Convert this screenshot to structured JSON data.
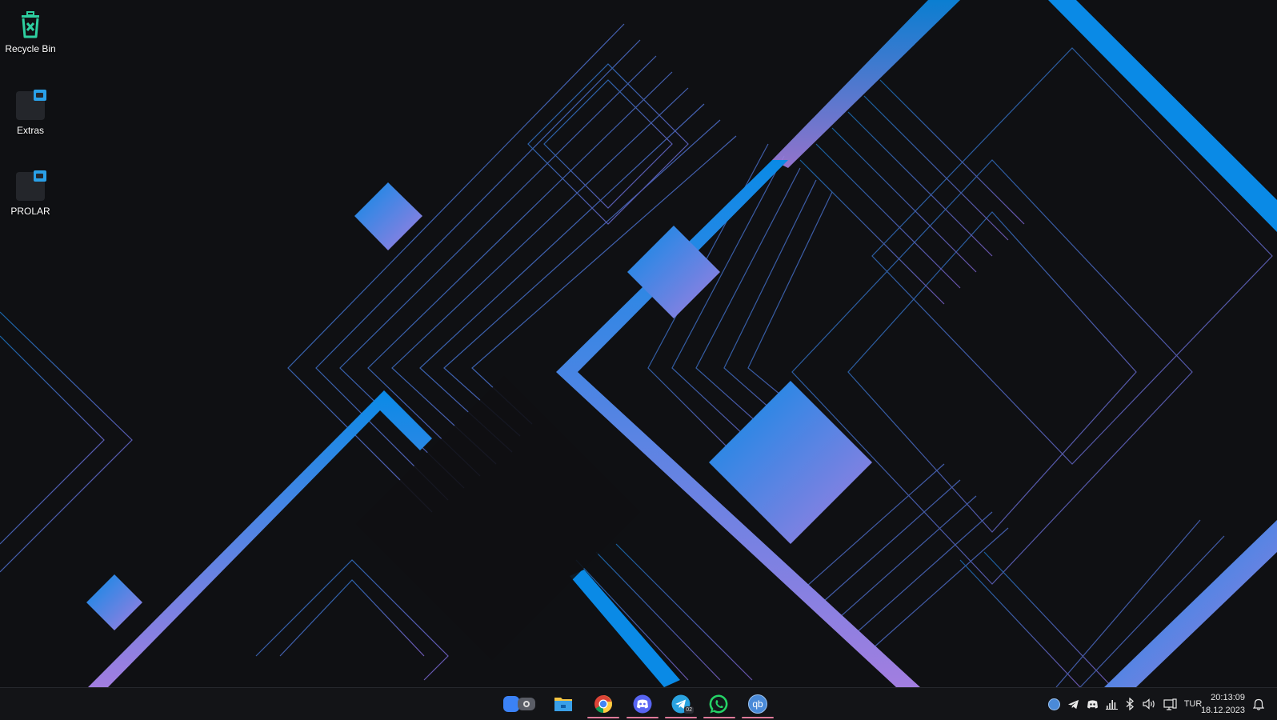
{
  "desktop": {
    "icons": [
      {
        "label": "Recycle Bin",
        "icon": "recycle-bin-icon"
      },
      {
        "label": "Extras",
        "icon": "folder-icon"
      },
      {
        "label": "PROLAR",
        "icon": "folder-icon"
      }
    ]
  },
  "taskbar": {
    "apps": [
      {
        "name": "task-view",
        "icon": "task-view-icon",
        "running": false
      },
      {
        "name": "file-explorer",
        "icon": "file-explorer-icon",
        "running": false
      },
      {
        "name": "chrome",
        "icon": "chrome-icon",
        "running": true
      },
      {
        "name": "discord",
        "icon": "discord-icon",
        "running": true
      },
      {
        "name": "telegram",
        "icon": "telegram-icon",
        "running": true,
        "badge": "02"
      },
      {
        "name": "whatsapp",
        "icon": "whatsapp-icon",
        "running": true
      },
      {
        "name": "qbittorrent",
        "icon": "qbittorrent-icon",
        "running": true,
        "label": "qb"
      }
    ],
    "tray": {
      "icons": [
        "qbittorrent-tray-icon",
        "telegram-tray-icon",
        "discord-tray-icon",
        "network-activity-icon",
        "bluetooth-icon",
        "volume-icon",
        "display-icon"
      ],
      "language": "TUR",
      "time": "20:13:09",
      "date": "18.12.2023",
      "notification_icon": "bell-icon"
    }
  },
  "colors": {
    "background": "#0f1013",
    "accent_blue": "#0a8ae6",
    "accent_purple": "#a27ee0",
    "taskbar": "#131417"
  }
}
